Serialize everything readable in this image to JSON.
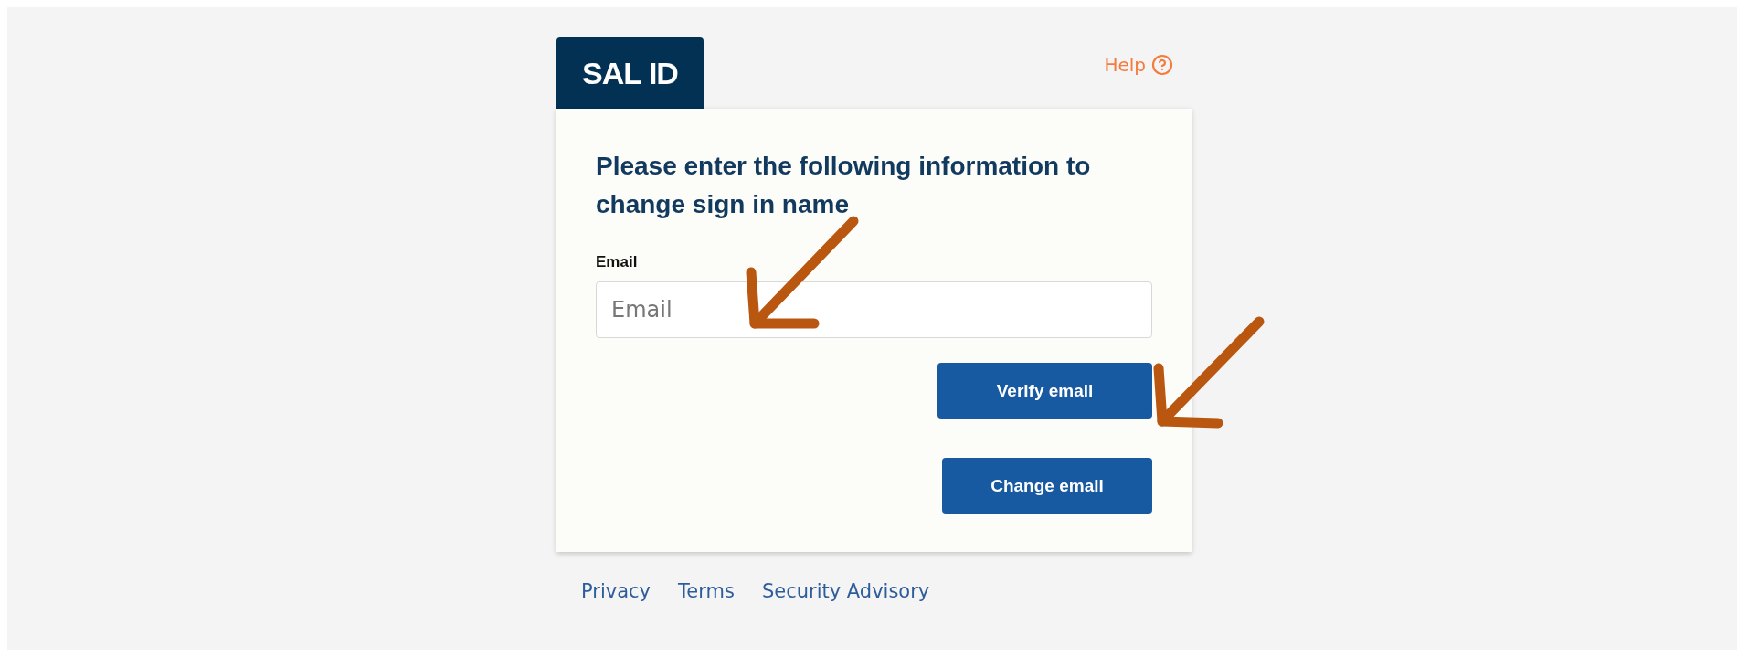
{
  "brand": {
    "logo": "SAL ID"
  },
  "help": {
    "label": "Help"
  },
  "form": {
    "title": "Please enter the following information to change sign in name",
    "email_label": "Email",
    "email_field": {
      "placeholder": "Email"
    },
    "buttons": [
      "Verify email",
      "Change email"
    ]
  },
  "footer_links": [
    "Privacy",
    "Terms",
    "Security Advisory"
  ],
  "annotations": [
    {
      "kind": "arrow"
    },
    {
      "kind": "arrow"
    }
  ]
}
